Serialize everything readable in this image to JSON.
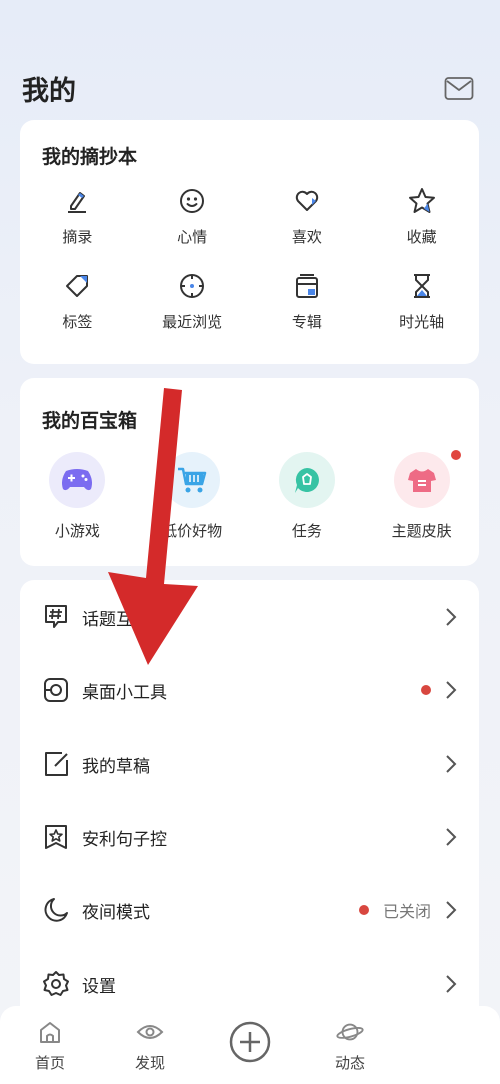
{
  "header": {
    "title": "我的",
    "mail_icon": "mail-icon"
  },
  "notebook": {
    "title": "我的摘抄本",
    "items": [
      {
        "label": "摘录",
        "icon": "pen-icon"
      },
      {
        "label": "心情",
        "icon": "smile-icon"
      },
      {
        "label": "喜欢",
        "icon": "heart-icon"
      },
      {
        "label": "收藏",
        "icon": "star-icon"
      },
      {
        "label": "标签",
        "icon": "tag-icon"
      },
      {
        "label": "最近浏览",
        "icon": "compass-icon"
      },
      {
        "label": "专辑",
        "icon": "album-icon"
      },
      {
        "label": "时光轴",
        "icon": "hourglass-icon"
      }
    ]
  },
  "treasure_box": {
    "title": "我的百宝箱",
    "items": [
      {
        "label": "小游戏",
        "icon": "gamepad-icon",
        "bg": "#ecebfb",
        "color": "#7b6cf0"
      },
      {
        "label": "低价好物",
        "icon": "cart-icon",
        "bg": "#e6f2fb",
        "color": "#3aa4e6"
      },
      {
        "label": "任务",
        "icon": "task-bubble-icon",
        "bg": "#e3f5f1",
        "color": "#37c3a4"
      },
      {
        "label": "主题皮肤",
        "icon": "shirt-icon",
        "bg": "#fde9ec",
        "color": "#ee6b85"
      }
    ]
  },
  "menu": [
    {
      "label": "话题互",
      "icon": "hashtag-icon"
    },
    {
      "label": "桌面小工具",
      "icon": "widget-icon",
      "dot": true
    },
    {
      "label": "我的草稿",
      "icon": "draft-icon"
    },
    {
      "label": "安利句子控",
      "icon": "bookmark-star-icon"
    },
    {
      "label": "夜间模式",
      "icon": "moon-icon",
      "dot": true,
      "value": "已关闭"
    },
    {
      "label": "设置",
      "icon": "gear-icon"
    }
  ],
  "bottom_nav": {
    "home": "首页",
    "discover": "发现",
    "add": "plus-circle-icon",
    "feed": "动态"
  },
  "colors": {
    "accent_red": "#d8473f",
    "annotation_arrow": "#d42a2a",
    "icon_blue": "#4a86e8"
  }
}
